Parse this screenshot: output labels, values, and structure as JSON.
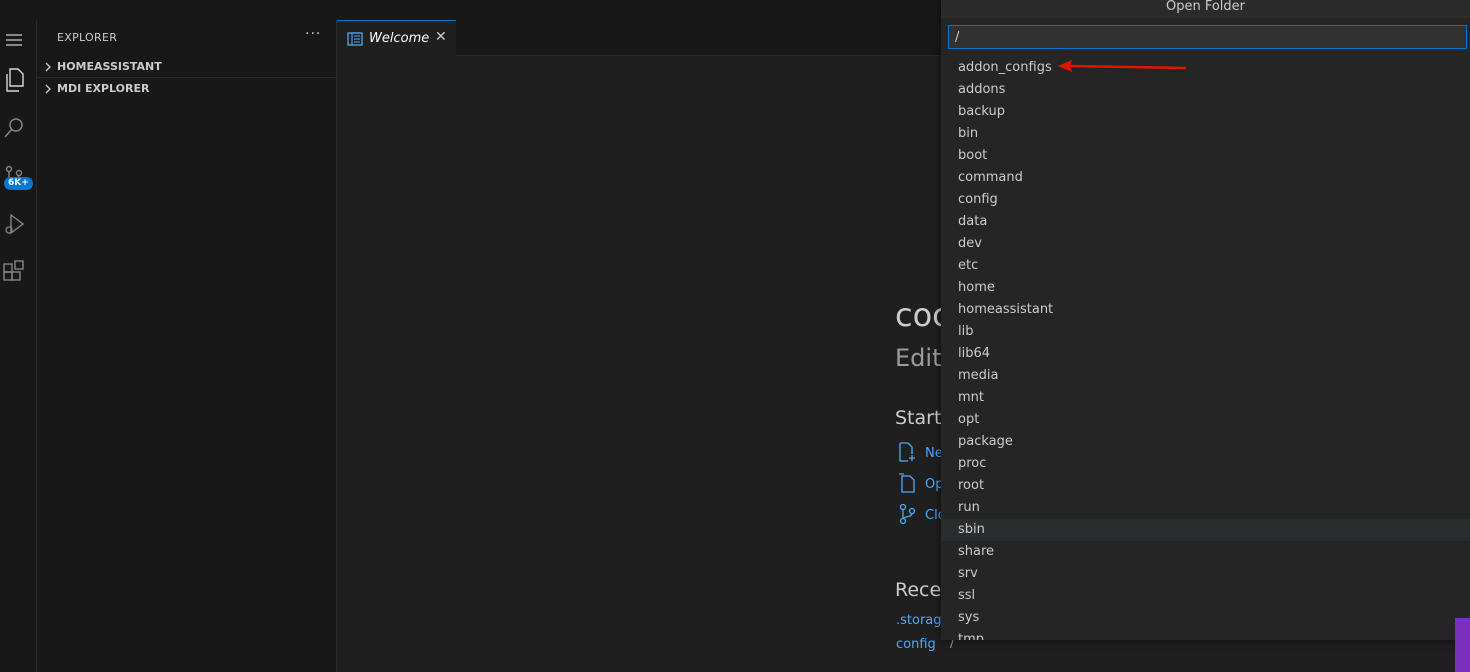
{
  "sidebar": {
    "title": "EXPLORER",
    "more": "···",
    "sections": [
      {
        "label": "HOMEASSISTANT"
      },
      {
        "label": "MDI EXPLORER"
      }
    ]
  },
  "activitybar": {
    "scm_badge": "6K+",
    "icons": [
      "menu-icon",
      "files-icon",
      "search-icon",
      "source-control-icon",
      "run-debug-icon",
      "extensions-icon"
    ]
  },
  "tab": {
    "label": "Welcome",
    "close": "✕"
  },
  "welcome": {
    "title": "coc",
    "subtitle": "Edit",
    "start_heading": "Start",
    "start_links": [
      "Ne",
      "Op",
      "Clo"
    ],
    "recent_heading": "Recen",
    "recent_items": [
      ".storag",
      "config"
    ],
    "recent_path": "/"
  },
  "quick_pick": {
    "title": "Open Folder",
    "input_value": "/",
    "items": [
      "addon_configs",
      "addons",
      "backup",
      "bin",
      "boot",
      "command",
      "config",
      "data",
      "dev",
      "etc",
      "home",
      "homeassistant",
      "lib",
      "lib64",
      "media",
      "mnt",
      "opt",
      "package",
      "proc",
      "root",
      "run",
      "sbin",
      "share",
      "srv",
      "ssl",
      "sys",
      "tmp"
    ],
    "selected_item": "sbin"
  },
  "colors": {
    "accent": "#0078d4",
    "link": "#4daafc",
    "annotation_arrow": "#e51400"
  }
}
